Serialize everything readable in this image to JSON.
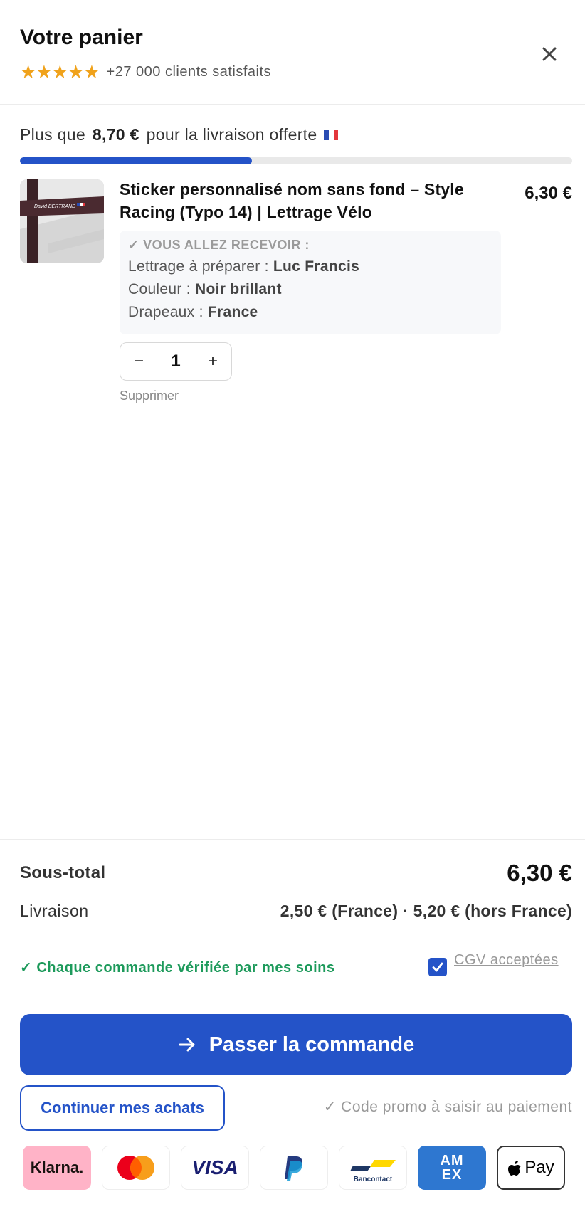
{
  "header": {
    "title": "Votre panier",
    "stars": "★★★★★",
    "rating_text": "+27 000 clients satisfaits",
    "close_icon": "close-icon"
  },
  "shipping_progress": {
    "prefix": "Plus que",
    "amount": "8,70 €",
    "suffix": "pour la livraison offerte",
    "flag": "france-flag",
    "progress_fraction": 0.42
  },
  "item": {
    "name": "Sticker personnalisé nom sans fond – Style Racing (Typo 14) | Lettrage Vélo",
    "price": "6,30 €",
    "image_text": "David BERTRAND",
    "details_title": "✓ VOUS ALLEZ RECEVOIR :",
    "details": [
      {
        "label": "Lettrage à préparer : ",
        "value": "Luc Francis"
      },
      {
        "label": "Couleur : ",
        "value": "Noir brillant"
      },
      {
        "label": "Drapeaux : ",
        "value": "France"
      }
    ],
    "qty_minus": "−",
    "quantity": "1",
    "qty_plus": "+",
    "remove_label": "Supprimer"
  },
  "summary": {
    "subtotal_label": "Sous-total",
    "subtotal_value": "6,30 €",
    "shipping_label": "Livraison",
    "shipping_value": "2,50 € (France) · 5,20 € (hors France)",
    "verified_text": "✓ Chaque commande vérifiée par mes soins",
    "cgv_label": "CGV acceptées",
    "cgv_checked": true
  },
  "actions": {
    "checkout_label": "Passer la commande",
    "continue_label": "Continuer mes achats",
    "promo_text": "✓ Code promo à saisir au paiement"
  },
  "payments": {
    "klarna": "Klarna.",
    "mastercard": "mastercard-logo",
    "visa": "VISA",
    "paypal": "paypal-logo",
    "bancontact": "Bancontact",
    "amex": "AM EX",
    "applepay": "Pay"
  },
  "colors": {
    "accent": "#2453c8",
    "star": "#f0a21b",
    "success": "#1d9a5b"
  }
}
